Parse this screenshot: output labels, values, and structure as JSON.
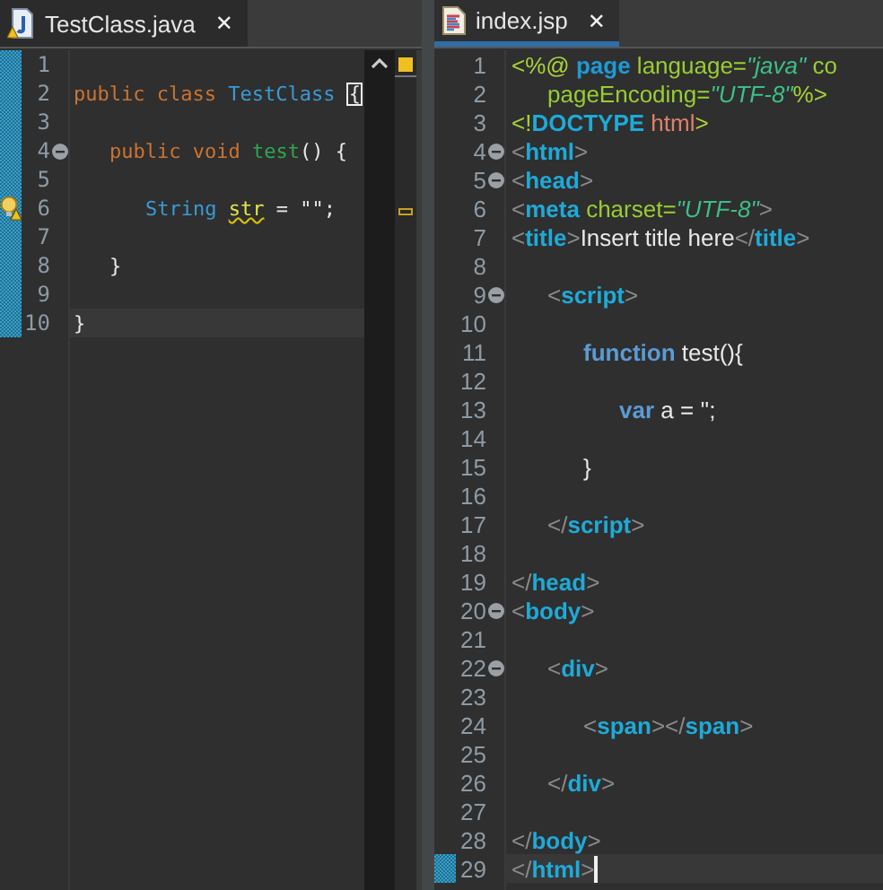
{
  "editors": [
    {
      "tab": {
        "title": "TestClass.java",
        "kind": "java",
        "selected": false,
        "close": "✕"
      },
      "ruler": true,
      "lines": [
        {
          "number": "1",
          "changed": true,
          "warning": false,
          "fold": false,
          "current": false
        },
        {
          "number": "2",
          "changed": true,
          "warning": false,
          "fold": false,
          "current": false,
          "tokens": [
            {
              "kind": "kw",
              "text": "public class "
            },
            {
              "kind": "type",
              "text": "TestClass "
            },
            {
              "kind": "match",
              "text": "{"
            }
          ]
        },
        {
          "number": "3",
          "changed": true,
          "warning": false,
          "fold": false,
          "current": false
        },
        {
          "number": "4",
          "changed": true,
          "warning": false,
          "fold": true,
          "current": false,
          "tokens": [
            {
              "kind": "kw",
              "text": "\tpublic void "
            },
            {
              "kind": "method",
              "text": "test"
            },
            {
              "kind": "plain",
              "text": "() {"
            }
          ]
        },
        {
          "number": "5",
          "changed": true,
          "warning": false,
          "fold": false,
          "current": false
        },
        {
          "number": "6",
          "changed": true,
          "warning": true,
          "fold": false,
          "current": false,
          "tokens": [
            {
              "kind": "type",
              "text": "\t\tString "
            },
            {
              "kind": "warnvar",
              "text": "str"
            },
            {
              "kind": "plain",
              "text": " = \"\";"
            }
          ]
        },
        {
          "number": "7",
          "changed": true,
          "warning": false,
          "fold": false,
          "current": false
        },
        {
          "number": "8",
          "changed": true,
          "warning": false,
          "fold": false,
          "current": false,
          "tokens": [
            {
              "kind": "plain",
              "text": "\t}"
            }
          ]
        },
        {
          "number": "9",
          "changed": true,
          "warning": false,
          "fold": false,
          "current": false
        },
        {
          "number": "10",
          "changed": true,
          "warning": false,
          "fold": false,
          "current": true,
          "tokens": [
            {
              "kind": "plain",
              "text": "}"
            }
          ]
        }
      ]
    },
    {
      "tab": {
        "title": "index.jsp",
        "kind": "jsp",
        "selected": true,
        "close": "✕"
      },
      "ruler": false,
      "lines": [
        {
          "number": "1",
          "changed": false,
          "warning": false,
          "fold": false,
          "current": false,
          "tokens": [
            {
              "kind": "directive",
              "text": "<%@ "
            },
            {
              "kind": "dkw",
              "text": "page"
            },
            {
              "kind": "attr",
              "text": " language="
            },
            {
              "kind": "value",
              "text": "\"java\""
            },
            {
              "kind": "attr",
              "text": " co"
            }
          ]
        },
        {
          "number": "2",
          "changed": false,
          "warning": false,
          "fold": false,
          "current": false,
          "tokens": [
            {
              "kind": "attr",
              "text": "\tpageEncoding="
            },
            {
              "kind": "value",
              "text": "\"UTF-8\""
            },
            {
              "kind": "directive",
              "text": "%>"
            }
          ]
        },
        {
          "number": "3",
          "changed": false,
          "warning": false,
          "fold": false,
          "current": false,
          "tokens": [
            {
              "kind": "directive",
              "text": "<!"
            },
            {
              "kind": "tag",
              "text": "DOCTYPE"
            },
            {
              "kind": "doctype",
              "text": " html"
            },
            {
              "kind": "directive",
              "text": ">"
            }
          ]
        },
        {
          "number": "4",
          "changed": false,
          "warning": false,
          "fold": true,
          "current": false,
          "tokens": [
            {
              "kind": "punct",
              "text": "<"
            },
            {
              "kind": "tag",
              "text": "html"
            },
            {
              "kind": "punct",
              "text": ">"
            }
          ]
        },
        {
          "number": "5",
          "changed": false,
          "warning": false,
          "fold": true,
          "current": false,
          "tokens": [
            {
              "kind": "punct",
              "text": "<"
            },
            {
              "kind": "tag",
              "text": "head"
            },
            {
              "kind": "punct",
              "text": ">"
            }
          ]
        },
        {
          "number": "6",
          "changed": false,
          "warning": false,
          "fold": false,
          "current": false,
          "tokens": [
            {
              "kind": "punct",
              "text": "<"
            },
            {
              "kind": "tag",
              "text": "meta"
            },
            {
              "kind": "attr",
              "text": " charset="
            },
            {
              "kind": "value",
              "text": "\"UTF-8\""
            },
            {
              "kind": "punct",
              "text": ">"
            }
          ]
        },
        {
          "number": "7",
          "changed": false,
          "warning": false,
          "fold": false,
          "current": false,
          "tokens": [
            {
              "kind": "punct",
              "text": "<"
            },
            {
              "kind": "tag",
              "text": "title"
            },
            {
              "kind": "punct",
              "text": ">"
            },
            {
              "kind": "plain",
              "text": "Insert title here"
            },
            {
              "kind": "punct",
              "text": "</"
            },
            {
              "kind": "tag",
              "text": "title"
            },
            {
              "kind": "punct",
              "text": ">"
            }
          ]
        },
        {
          "number": "8",
          "changed": false,
          "warning": false,
          "fold": false,
          "current": false
        },
        {
          "number": "9",
          "changed": false,
          "warning": false,
          "fold": true,
          "current": false,
          "tokens": [
            {
              "kind": "punct",
              "text": "\t<"
            },
            {
              "kind": "tag",
              "text": "script"
            },
            {
              "kind": "punct",
              "text": ">"
            }
          ]
        },
        {
          "number": "10",
          "changed": false,
          "warning": false,
          "fold": false,
          "current": false
        },
        {
          "number": "11",
          "changed": false,
          "warning": false,
          "fold": false,
          "current": false,
          "tokens": [
            {
              "kind": "jskw",
              "text": "\t\tfunction"
            },
            {
              "kind": "plain",
              "text": " test(){"
            }
          ]
        },
        {
          "number": "12",
          "changed": false,
          "warning": false,
          "fold": false,
          "current": false
        },
        {
          "number": "13",
          "changed": false,
          "warning": false,
          "fold": false,
          "current": false,
          "tokens": [
            {
              "kind": "jskw",
              "text": "\t\t\tvar"
            },
            {
              "kind": "plain",
              "text": " a = '';"
            }
          ]
        },
        {
          "number": "14",
          "changed": false,
          "warning": false,
          "fold": false,
          "current": false
        },
        {
          "number": "15",
          "changed": false,
          "warning": false,
          "fold": false,
          "current": false,
          "tokens": [
            {
              "kind": "plain",
              "text": "\t\t}"
            }
          ]
        },
        {
          "number": "16",
          "changed": false,
          "warning": false,
          "fold": false,
          "current": false
        },
        {
          "number": "17",
          "changed": false,
          "warning": false,
          "fold": false,
          "current": false,
          "tokens": [
            {
              "kind": "punct",
              "text": "\t</"
            },
            {
              "kind": "tag",
              "text": "script"
            },
            {
              "kind": "punct",
              "text": ">"
            }
          ]
        },
        {
          "number": "18",
          "changed": false,
          "warning": false,
          "fold": false,
          "current": false
        },
        {
          "number": "19",
          "changed": false,
          "warning": false,
          "fold": false,
          "current": false,
          "tokens": [
            {
              "kind": "punct",
              "text": "</"
            },
            {
              "kind": "tag",
              "text": "head"
            },
            {
              "kind": "punct",
              "text": ">"
            }
          ]
        },
        {
          "number": "20",
          "changed": false,
          "warning": false,
          "fold": true,
          "current": false,
          "tokens": [
            {
              "kind": "punct",
              "text": "<"
            },
            {
              "kind": "tag",
              "text": "body"
            },
            {
              "kind": "punct",
              "text": ">"
            }
          ]
        },
        {
          "number": "21",
          "changed": false,
          "warning": false,
          "fold": false,
          "current": false
        },
        {
          "number": "22",
          "changed": false,
          "warning": false,
          "fold": true,
          "current": false,
          "tokens": [
            {
              "kind": "punct",
              "text": "\t<"
            },
            {
              "kind": "tag",
              "text": "div"
            },
            {
              "kind": "punct",
              "text": ">"
            }
          ]
        },
        {
          "number": "23",
          "changed": false,
          "warning": false,
          "fold": false,
          "current": false
        },
        {
          "number": "24",
          "changed": false,
          "warning": false,
          "fold": false,
          "current": false,
          "tokens": [
            {
              "kind": "punct",
              "text": "\t\t<"
            },
            {
              "kind": "tag",
              "text": "span"
            },
            {
              "kind": "punct",
              "text": "></"
            },
            {
              "kind": "tag",
              "text": "span"
            },
            {
              "kind": "punct",
              "text": ">"
            }
          ]
        },
        {
          "number": "25",
          "changed": false,
          "warning": false,
          "fold": false,
          "current": false
        },
        {
          "number": "26",
          "changed": false,
          "warning": false,
          "fold": false,
          "current": false,
          "tokens": [
            {
              "kind": "punct",
              "text": "\t</"
            },
            {
              "kind": "tag",
              "text": "div"
            },
            {
              "kind": "punct",
              "text": ">"
            }
          ]
        },
        {
          "number": "27",
          "changed": false,
          "warning": false,
          "fold": false,
          "current": false
        },
        {
          "number": "28",
          "changed": false,
          "warning": false,
          "fold": false,
          "current": false,
          "tokens": [
            {
              "kind": "punct",
              "text": "</"
            },
            {
              "kind": "tag",
              "text": "body"
            },
            {
              "kind": "punct",
              "text": ">"
            }
          ]
        },
        {
          "number": "29",
          "changed": true,
          "warning": false,
          "fold": false,
          "current": true,
          "tokens": [
            {
              "kind": "punct",
              "text": "</"
            },
            {
              "kind": "tag",
              "text": "html"
            },
            {
              "kind": "punct",
              "text": ">"
            }
          ]
        }
      ]
    }
  ]
}
